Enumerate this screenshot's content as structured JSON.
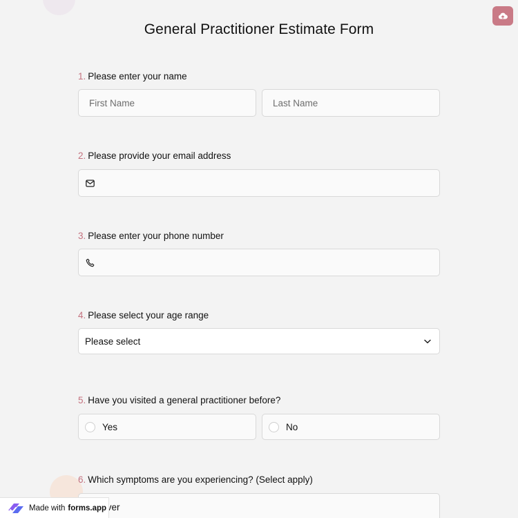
{
  "form": {
    "title": "General Practitioner Estimate Form"
  },
  "questions": [
    {
      "number": "1.",
      "label": "Please enter your name",
      "first_placeholder": "First Name",
      "last_placeholder": "Last Name"
    },
    {
      "number": "2.",
      "label": "Please provide your email address",
      "value": ""
    },
    {
      "number": "3.",
      "label": "Please enter your phone number",
      "value": ""
    },
    {
      "number": "4.",
      "label": "Please select your age range",
      "selected": "Please select"
    },
    {
      "number": "5.",
      "label": "Have you visited a general practitioner before?",
      "options": [
        "Yes",
        "No"
      ]
    },
    {
      "number": "6.",
      "label": "Which symptoms are you experiencing? (Select apply)",
      "options": [
        "Fever"
      ]
    }
  ],
  "badge": {
    "prefix": "Made with",
    "brand": "forms.app"
  },
  "colors": {
    "accent": "#c4727f",
    "save_button": "#c97a86",
    "background": "#f3f3f3"
  },
  "icons": {
    "save": "cloud-upload-icon",
    "email": "mail-icon",
    "phone": "phone-icon",
    "dropdown": "chevron-down-icon",
    "logo": "forms-app-logo-icon"
  }
}
